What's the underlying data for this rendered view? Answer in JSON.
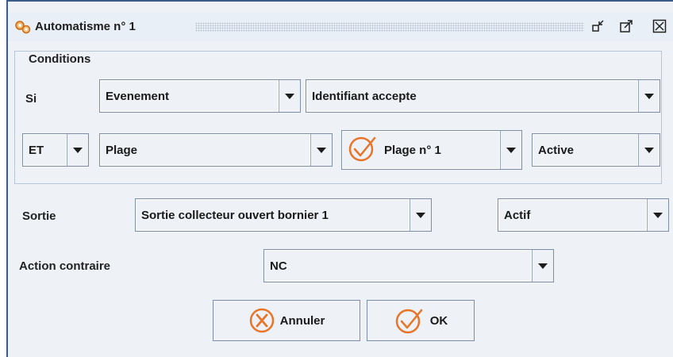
{
  "window": {
    "title": "Automatisme n° 1",
    "icons": [
      "gears-icon",
      "minimize-icon",
      "maximize-icon",
      "close-icon"
    ]
  },
  "conditions": {
    "group_title": "Conditions",
    "si_label": "Si",
    "type_value": "Evenement",
    "event_value": "Identifiant accepte",
    "operator_value": "ET",
    "subject_value": "Plage",
    "plage_value": "Plage n° 1",
    "state_value": "Active"
  },
  "sortie": {
    "label": "Sortie",
    "output_value": "Sortie collecteur ouvert bornier 1",
    "state_value": "Actif"
  },
  "action_contraire": {
    "label": "Action contraire",
    "value": "NC"
  },
  "buttons": {
    "cancel_label": "Annuler",
    "ok_label": "OK"
  },
  "colors": {
    "accent_orange": "#e8742a",
    "border": "#7d8ea4",
    "background": "#eef2f7"
  }
}
